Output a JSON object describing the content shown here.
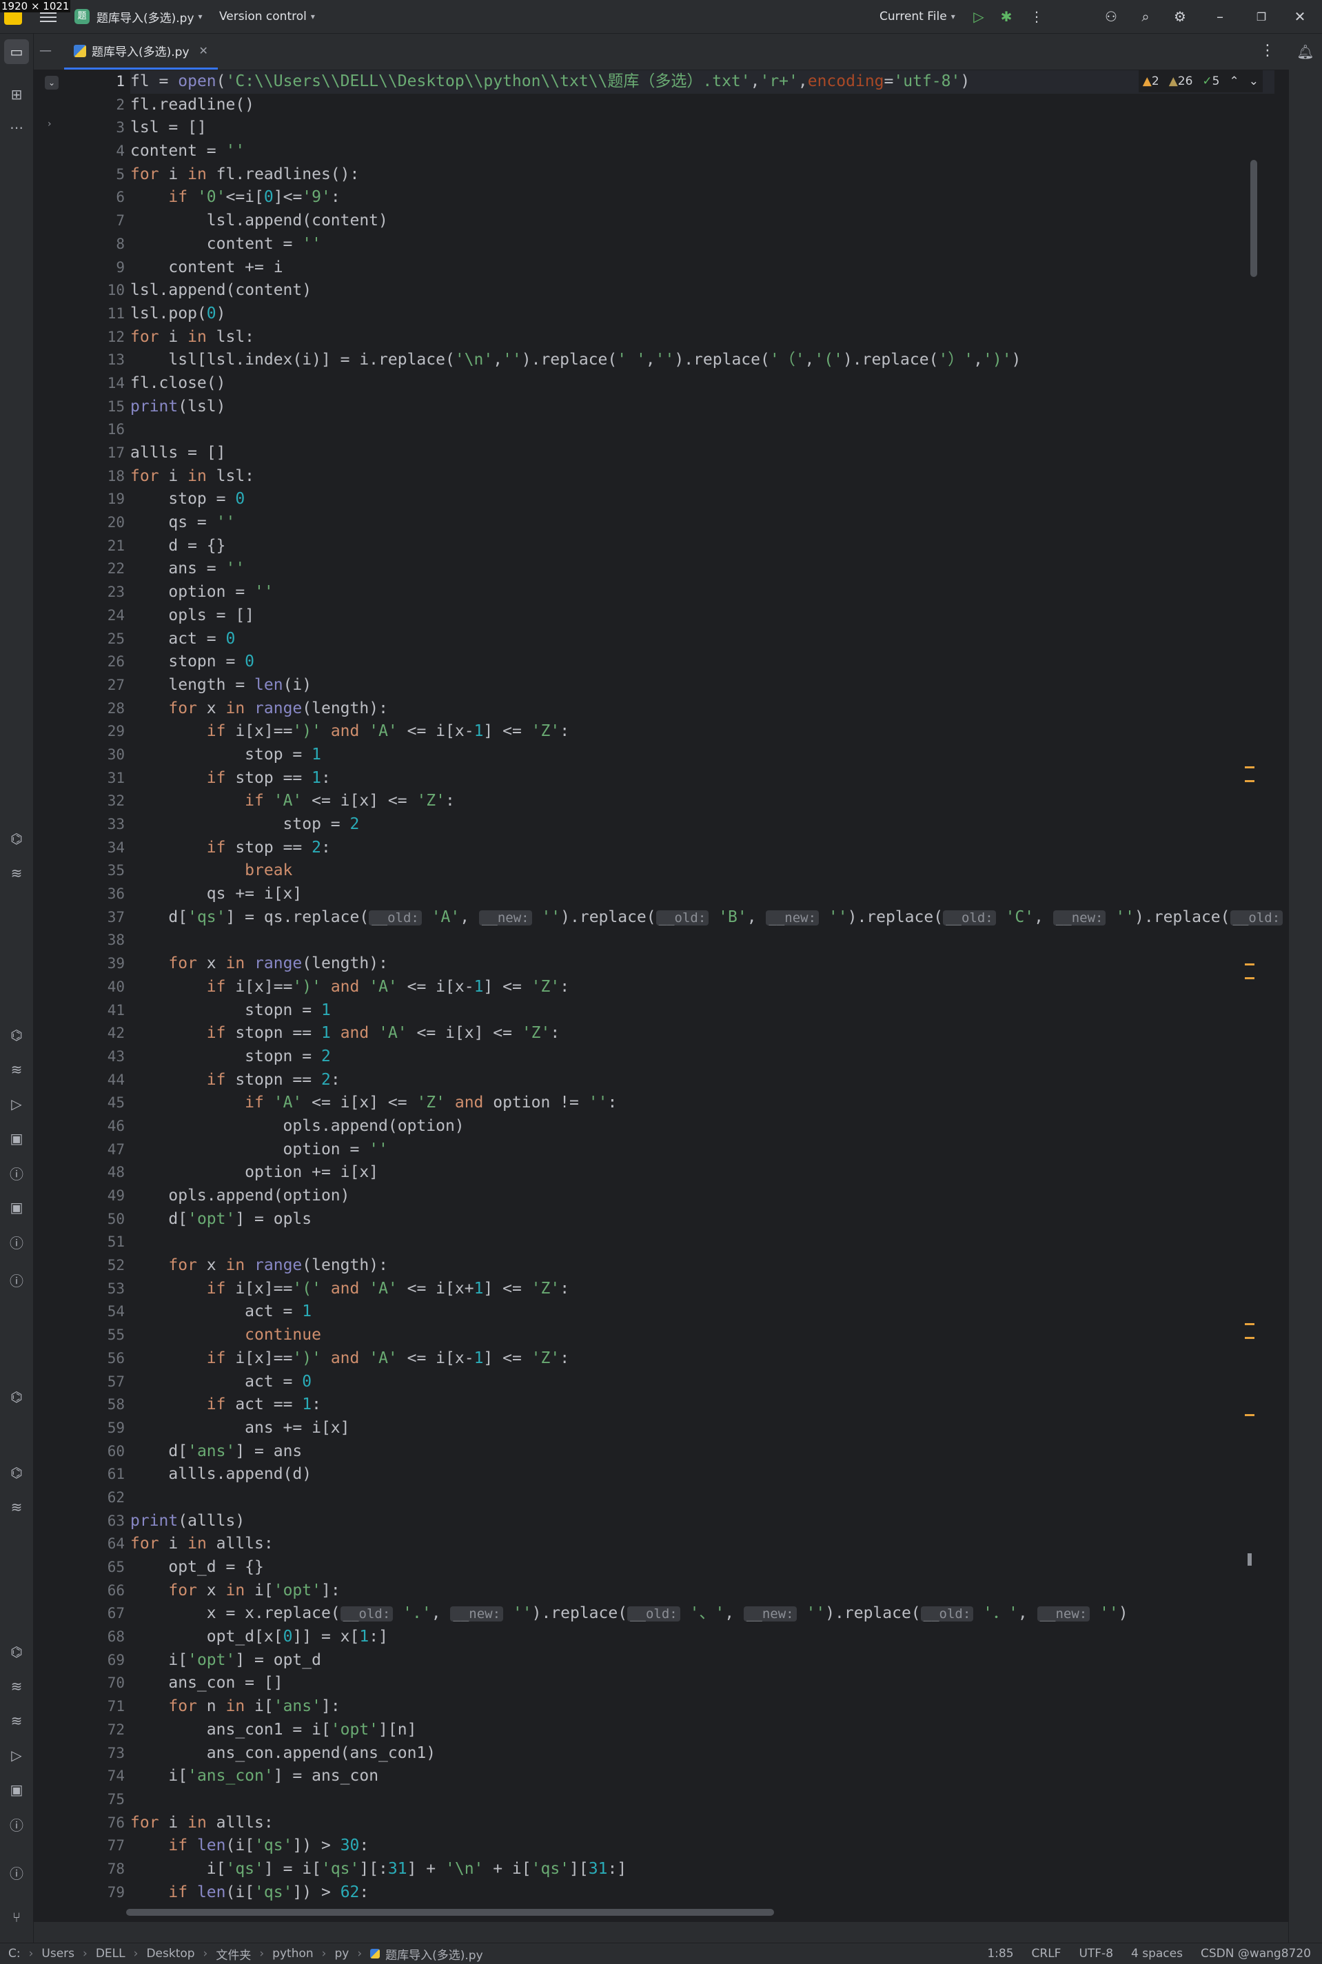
{
  "screen": {
    "size_label": "1920 × 1021"
  },
  "titlebar": {
    "project_badge": "题",
    "file_name": "题库导入(多选).py",
    "version_control": "Version control",
    "run_config": "Current File",
    "icons": [
      "run-icon",
      "debug-icon",
      "more-icon",
      "add-user-icon",
      "search-icon",
      "settings-icon",
      "minimize-icon",
      "restore-icon",
      "close-icon"
    ]
  },
  "tab": {
    "label": "题库导入(多选).py"
  },
  "inspections": {
    "warnings": "2",
    "weak_warnings": "26",
    "typos": "5"
  },
  "code": {
    "current_line": 1,
    "lines": [
      "fl = open('C:\\\\Users\\\\DELL\\\\Desktop\\\\python\\\\txt\\\\题库（多选）.txt','r+',encoding='utf-8')",
      "fl.readline()",
      "lsl = []",
      "content = ''",
      "for i in fl.readlines():",
      "    if '0'<=i[0]<='9':",
      "        lsl.append(content)",
      "        content = ''",
      "    content += i",
      "lsl.append(content)",
      "lsl.pop(0)",
      "for i in lsl:",
      "    lsl[lsl.index(i)] = i.replace('\\n','').replace(' ','').replace('（','(').replace('）',')')",
      "fl.close()",
      "print(lsl)",
      "",
      "allls = []",
      "for i in lsl:",
      "    stop = 0",
      "    qs = ''",
      "    d = {}",
      "    ans = ''",
      "    option = ''",
      "    opls = []",
      "    act = 0",
      "    stopn = 0",
      "    length = len(i)",
      "    for x in range(length):",
      "        if i[x]==')' and 'A' <= i[x-1] <= 'Z':",
      "            stop = 1",
      "        if stop == 1:",
      "            if 'A' <= i[x] <= 'Z':",
      "                stop = 2",
      "        if stop == 2:",
      "            break",
      "        qs += i[x]",
      "    d['qs'] = qs.replace(__old: 'A', __new: '').replace(__old: 'B', __new: '').replace(__old: 'C', __new: '').replace(__old: 'D', __ne",
      "",
      "    for x in range(length):",
      "        if i[x]==')' and 'A' <= i[x-1] <= 'Z':",
      "            stopn = 1",
      "        if stopn == 1 and 'A' <= i[x] <= 'Z':",
      "            stopn = 2",
      "        if stopn == 2:",
      "            if 'A' <= i[x] <= 'Z' and option != '':",
      "                opls.append(option)",
      "                option = ''",
      "            option += i[x]",
      "    opls.append(option)",
      "    d['opt'] = opls",
      "",
      "    for x in range(length):",
      "        if i[x]=='(' and 'A' <= i[x+1] <= 'Z':",
      "            act = 1",
      "            continue",
      "        if i[x]==')' and 'A' <= i[x-1] <= 'Z':",
      "            act = 0",
      "        if act == 1:",
      "            ans += i[x]",
      "    d['ans'] = ans",
      "    allls.append(d)",
      "",
      "print(allls)",
      "for i in allls:",
      "    opt_d = {}",
      "    for x in i['opt']:",
      "        x = x.replace(__old: '.', __new: '').replace(__old: '、', __new: '').replace(__old: '．', __new: '')",
      "        opt_d[x[0]] = x[1:]",
      "    i['opt'] = opt_d",
      "    ans_con = []",
      "    for n in i['ans']:",
      "        ans_con1 = i['opt'][n]",
      "        ans_con.append(ans_con1)",
      "    i['ans_con'] = ans_con",
      "",
      "for i in allls:",
      "    if len(i['qs']) > 30:",
      "        i['qs'] = i['qs'][:31] + '\\n' + i['qs'][31:]",
      "    if len(i['qs']) > 62:"
    ]
  },
  "statusbar": {
    "breadcrumbs": [
      "C:",
      "Users",
      "DELL",
      "Desktop",
      "文件夹",
      "python",
      "py",
      "题库导入(多选).py"
    ],
    "position": "1:85",
    "line_sep": "CRLF",
    "encoding": "UTF-8",
    "indent": "4 spaces",
    "watermark": "CSDN @wang8720"
  }
}
